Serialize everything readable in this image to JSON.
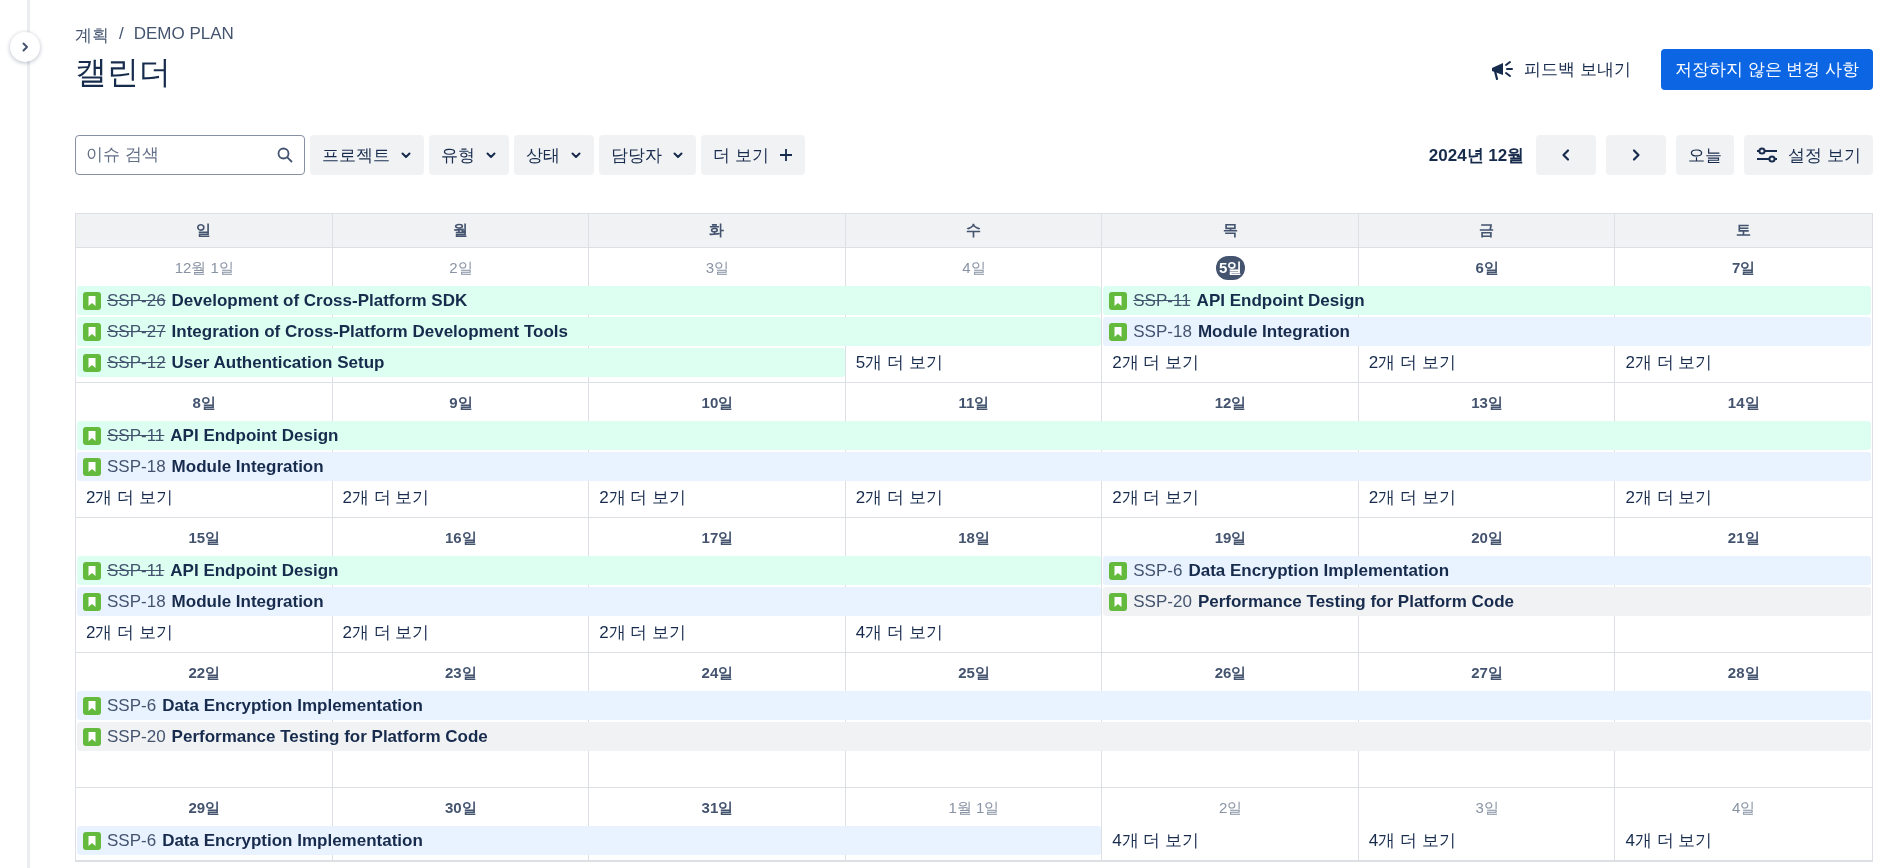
{
  "breadcrumbs": [
    "계획",
    "DEMO PLAN"
  ],
  "breadcrumb_separator": "/",
  "title": "캘린더",
  "feedback_button": "피드백 보내기",
  "primary_button": "저장하지 않은 변경 사항",
  "search": {
    "placeholder": "이슈 검색"
  },
  "filters": [
    {
      "label": "프로젝트",
      "kind": "dropdown"
    },
    {
      "label": "유형",
      "kind": "dropdown"
    },
    {
      "label": "상태",
      "kind": "dropdown"
    },
    {
      "label": "담당자",
      "kind": "dropdown"
    },
    {
      "label": "더 보기",
      "kind": "add"
    }
  ],
  "month_label": "2024년 12월",
  "today_button": "오늘",
  "view_settings_button": "설정 보기",
  "weekdays": [
    "일",
    "월",
    "화",
    "수",
    "목",
    "금",
    "토"
  ],
  "weeks": [
    {
      "days": [
        {
          "label": "12월 1일",
          "outside": true,
          "today": false
        },
        {
          "label": "2일",
          "outside": true,
          "today": false
        },
        {
          "label": "3일",
          "outside": true,
          "today": false
        },
        {
          "label": "4일",
          "outside": true,
          "today": false
        },
        {
          "label": "5일",
          "outside": false,
          "today": true
        },
        {
          "label": "6일",
          "outside": false,
          "today": false
        },
        {
          "label": "7일",
          "outside": false,
          "today": false
        }
      ],
      "lanes": [
        [
          {
            "kind": "event",
            "key": "SSP-26",
            "title": "Development of Cross-Platform SDK",
            "done": true,
            "color": "#dcfff1"
          },
          {
            "kind": "continue"
          },
          {
            "kind": "continue"
          },
          {
            "kind": "continue"
          },
          {
            "kind": "event",
            "key": "SSP-11",
            "title": "API Endpoint Design",
            "done": true,
            "color": "#dcfff1"
          },
          {
            "kind": "continue"
          },
          {
            "kind": "continue"
          }
        ],
        [
          {
            "kind": "event",
            "key": "SSP-27",
            "title": "Integration of Cross-Platform Development Tools",
            "done": true,
            "color": "#dcfff1"
          },
          {
            "kind": "continue"
          },
          {
            "kind": "continue"
          },
          {
            "kind": "continue"
          },
          {
            "kind": "event",
            "key": "SSP-18",
            "title": "Module Integration",
            "done": false,
            "color": "#e9f2ff"
          },
          {
            "kind": "continue"
          },
          {
            "kind": "continue"
          }
        ],
        [
          {
            "kind": "event",
            "key": "SSP-12",
            "title": "User Authentication Setup",
            "done": true,
            "color": "#dcfff1"
          },
          {
            "kind": "continue"
          },
          {
            "kind": "continue"
          },
          {
            "kind": "more",
            "text": "5개 더 보기"
          },
          {
            "kind": "more",
            "text": "2개 더 보기"
          },
          {
            "kind": "more",
            "text": "2개 더 보기"
          },
          {
            "kind": "more",
            "text": "2개 더 보기"
          }
        ]
      ]
    },
    {
      "days": [
        {
          "label": "8일",
          "outside": false,
          "today": false
        },
        {
          "label": "9일",
          "outside": false,
          "today": false
        },
        {
          "label": "10일",
          "outside": false,
          "today": false
        },
        {
          "label": "11일",
          "outside": false,
          "today": false
        },
        {
          "label": "12일",
          "outside": false,
          "today": false
        },
        {
          "label": "13일",
          "outside": false,
          "today": false
        },
        {
          "label": "14일",
          "outside": false,
          "today": false
        }
      ],
      "lanes": [
        [
          {
            "kind": "event",
            "key": "SSP-11",
            "title": "API Endpoint Design",
            "done": true,
            "color": "#dcfff1"
          },
          {
            "kind": "continue"
          },
          {
            "kind": "continue"
          },
          {
            "kind": "continue"
          },
          {
            "kind": "continue"
          },
          {
            "kind": "continue"
          },
          {
            "kind": "continue"
          }
        ],
        [
          {
            "kind": "event",
            "key": "SSP-18",
            "title": "Module Integration",
            "done": false,
            "color": "#e9f2ff"
          },
          {
            "kind": "continue"
          },
          {
            "kind": "continue"
          },
          {
            "kind": "continue"
          },
          {
            "kind": "continue"
          },
          {
            "kind": "continue"
          },
          {
            "kind": "continue"
          }
        ],
        [
          {
            "kind": "more",
            "text": "2개 더 보기"
          },
          {
            "kind": "more",
            "text": "2개 더 보기"
          },
          {
            "kind": "more",
            "text": "2개 더 보기"
          },
          {
            "kind": "more",
            "text": "2개 더 보기"
          },
          {
            "kind": "more",
            "text": "2개 더 보기"
          },
          {
            "kind": "more",
            "text": "2개 더 보기"
          },
          {
            "kind": "more",
            "text": "2개 더 보기"
          }
        ]
      ]
    },
    {
      "days": [
        {
          "label": "15일",
          "outside": false,
          "today": false
        },
        {
          "label": "16일",
          "outside": false,
          "today": false
        },
        {
          "label": "17일",
          "outside": false,
          "today": false
        },
        {
          "label": "18일",
          "outside": false,
          "today": false
        },
        {
          "label": "19일",
          "outside": false,
          "today": false
        },
        {
          "label": "20일",
          "outside": false,
          "today": false
        },
        {
          "label": "21일",
          "outside": false,
          "today": false
        }
      ],
      "lanes": [
        [
          {
            "kind": "event",
            "key": "SSP-11",
            "title": "API Endpoint Design",
            "done": true,
            "color": "#dcfff1"
          },
          {
            "kind": "continue"
          },
          {
            "kind": "continue"
          },
          {
            "kind": "continue"
          },
          {
            "kind": "event",
            "key": "SSP-6",
            "title": "Data Encryption Implementation",
            "done": false,
            "color": "#e9f2ff"
          },
          {
            "kind": "continue"
          },
          {
            "kind": "continue"
          }
        ],
        [
          {
            "kind": "event",
            "key": "SSP-18",
            "title": "Module Integration",
            "done": false,
            "color": "#e9f2ff"
          },
          {
            "kind": "continue"
          },
          {
            "kind": "continue"
          },
          {
            "kind": "continue"
          },
          {
            "kind": "event",
            "key": "SSP-20",
            "title": "Performance Testing for Platform Code",
            "done": false,
            "color": "#f1f2f4"
          },
          {
            "kind": "continue"
          },
          {
            "kind": "continue"
          }
        ],
        [
          {
            "kind": "more",
            "text": "2개 더 보기"
          },
          {
            "kind": "more",
            "text": "2개 더 보기"
          },
          {
            "kind": "more",
            "text": "2개 더 보기"
          },
          {
            "kind": "more",
            "text": "4개 더 보기"
          },
          {
            "kind": "empty"
          },
          {
            "kind": "empty"
          },
          {
            "kind": "empty"
          }
        ]
      ]
    },
    {
      "days": [
        {
          "label": "22일",
          "outside": false,
          "today": false
        },
        {
          "label": "23일",
          "outside": false,
          "today": false
        },
        {
          "label": "24일",
          "outside": false,
          "today": false
        },
        {
          "label": "25일",
          "outside": false,
          "today": false
        },
        {
          "label": "26일",
          "outside": false,
          "today": false
        },
        {
          "label": "27일",
          "outside": false,
          "today": false
        },
        {
          "label": "28일",
          "outside": false,
          "today": false
        }
      ],
      "lanes": [
        [
          {
            "kind": "event",
            "key": "SSP-6",
            "title": "Data Encryption Implementation",
            "done": false,
            "color": "#e9f2ff"
          },
          {
            "kind": "continue"
          },
          {
            "kind": "continue"
          },
          {
            "kind": "continue"
          },
          {
            "kind": "continue"
          },
          {
            "kind": "continue"
          },
          {
            "kind": "continue"
          }
        ],
        [
          {
            "kind": "event",
            "key": "SSP-20",
            "title": "Performance Testing for Platform Code",
            "done": false,
            "color": "#f1f2f4"
          },
          {
            "kind": "continue"
          },
          {
            "kind": "continue"
          },
          {
            "kind": "continue"
          },
          {
            "kind": "continue"
          },
          {
            "kind": "continue"
          },
          {
            "kind": "continue"
          }
        ],
        [
          {
            "kind": "empty"
          },
          {
            "kind": "empty"
          },
          {
            "kind": "empty"
          },
          {
            "kind": "empty"
          },
          {
            "kind": "empty"
          },
          {
            "kind": "empty"
          },
          {
            "kind": "empty"
          }
        ]
      ]
    },
    {
      "days": [
        {
          "label": "29일",
          "outside": false,
          "today": false
        },
        {
          "label": "30일",
          "outside": false,
          "today": false
        },
        {
          "label": "31일",
          "outside": false,
          "today": false
        },
        {
          "label": "1월 1일",
          "outside": true,
          "today": false
        },
        {
          "label": "2일",
          "outside": true,
          "today": false
        },
        {
          "label": "3일",
          "outside": true,
          "today": false
        },
        {
          "label": "4일",
          "outside": true,
          "today": false
        }
      ],
      "lanes": [
        [
          {
            "kind": "event",
            "key": "SSP-6",
            "title": "Data Encryption Implementation",
            "done": false,
            "color": "#e9f2ff"
          },
          {
            "kind": "continue"
          },
          {
            "kind": "continue"
          },
          {
            "kind": "continue"
          },
          {
            "kind": "more",
            "text": "4개 더 보기"
          },
          {
            "kind": "more",
            "text": "4개 더 보기"
          },
          {
            "kind": "more",
            "text": "4개 더 보기"
          }
        ]
      ]
    }
  ]
}
